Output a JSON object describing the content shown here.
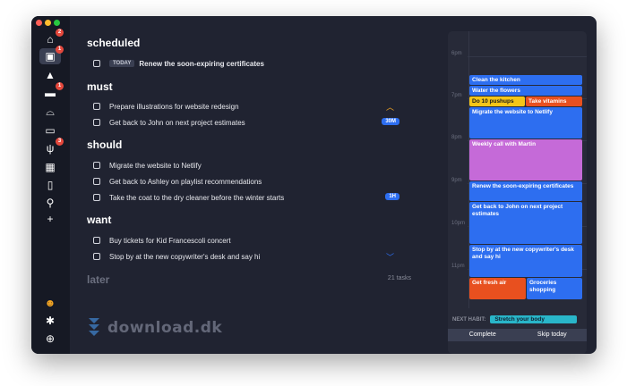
{
  "colors": {
    "window_bg": "#202331",
    "sidebar_bg": "#161924",
    "accent": "#2d6ef0",
    "badge": "#e5483c"
  },
  "sidebar": {
    "items": [
      {
        "icon": "home-icon",
        "glyph": "⌂",
        "badge": "2"
      },
      {
        "icon": "briefcase-icon",
        "glyph": "▣",
        "badge": "1"
      },
      {
        "icon": "graduation-cap-icon",
        "glyph": "▲",
        "badge": ""
      },
      {
        "icon": "car-icon",
        "glyph": "▬",
        "badge": "1"
      },
      {
        "icon": "basket-icon",
        "glyph": "⌓",
        "badge": ""
      },
      {
        "icon": "clapperboard-icon",
        "glyph": "▭",
        "badge": ""
      },
      {
        "icon": "fork-knife-icon",
        "glyph": "ψ",
        "badge": "3"
      },
      {
        "icon": "grid-icon",
        "glyph": "▦",
        "badge": ""
      },
      {
        "icon": "book-icon",
        "glyph": "▯",
        "badge": ""
      },
      {
        "icon": "search-icon",
        "glyph": "⚲",
        "badge": ""
      },
      {
        "icon": "add-icon",
        "glyph": "+",
        "badge": ""
      }
    ],
    "bottom": [
      {
        "icon": "smiley-icon",
        "glyph": "☻"
      },
      {
        "icon": "gear-icon",
        "glyph": "✱"
      },
      {
        "icon": "add-circle-icon",
        "glyph": "⊕"
      }
    ]
  },
  "sections": {
    "scheduled": "scheduled",
    "must": "must",
    "should": "should",
    "want": "want",
    "later": "later",
    "later_count": "21 tasks"
  },
  "tasks": {
    "scheduled": [
      {
        "pill": "TODAY",
        "text": "Renew the soon-expiring certificates"
      }
    ],
    "must": [
      {
        "text": "Prepare illustrations for website redesign"
      },
      {
        "text": "Get back to John on next project estimates",
        "tag": "30M"
      }
    ],
    "should": [
      {
        "text": "Migrate the website to Netlify"
      },
      {
        "text": "Get back to Ashley on playlist recommendations"
      },
      {
        "text": "Take the coat to the dry cleaner before the winter starts",
        "tag": "1H"
      }
    ],
    "want": [
      {
        "text": "Buy tickets for Kid Francescoli concert"
      },
      {
        "text": "Stop by at the new copywriter's desk and say hi"
      }
    ]
  },
  "calendar": {
    "hours": [
      "6pm",
      "7pm",
      "8pm",
      "9pm",
      "10pm",
      "11pm"
    ],
    "events": [
      {
        "text": "Clean the kitchen",
        "color": "#2d6ef0"
      },
      {
        "text": "Water the flowers",
        "color": "#2d6ef0"
      },
      {
        "text": "Do 10 pushups",
        "color": "#f5c518"
      },
      {
        "text": "Take vitamins",
        "color": "#e8501f"
      },
      {
        "text": "Migrate the website to Netlify",
        "color": "#2d6ef0"
      },
      {
        "text": "Weekly call with Martin",
        "color": "#c56ad8"
      },
      {
        "text": "Renew the soon-expiring certificates",
        "color": "#2d6ef0"
      },
      {
        "text": "Get back to John on next project estimates",
        "color": "#2d6ef0"
      },
      {
        "text": "Stop by at the new copywriter's desk and say hi",
        "color": "#2d6ef0"
      },
      {
        "text": "Get fresh air",
        "color": "#e8501f"
      },
      {
        "text": "Groceries shopping",
        "color": "#2d6ef0"
      }
    ],
    "next_habit_label": "NEXT HABIT:",
    "next_habit": "Stretch your body",
    "complete": "Complete",
    "skip": "Skip today"
  },
  "watermark": "download.dk"
}
